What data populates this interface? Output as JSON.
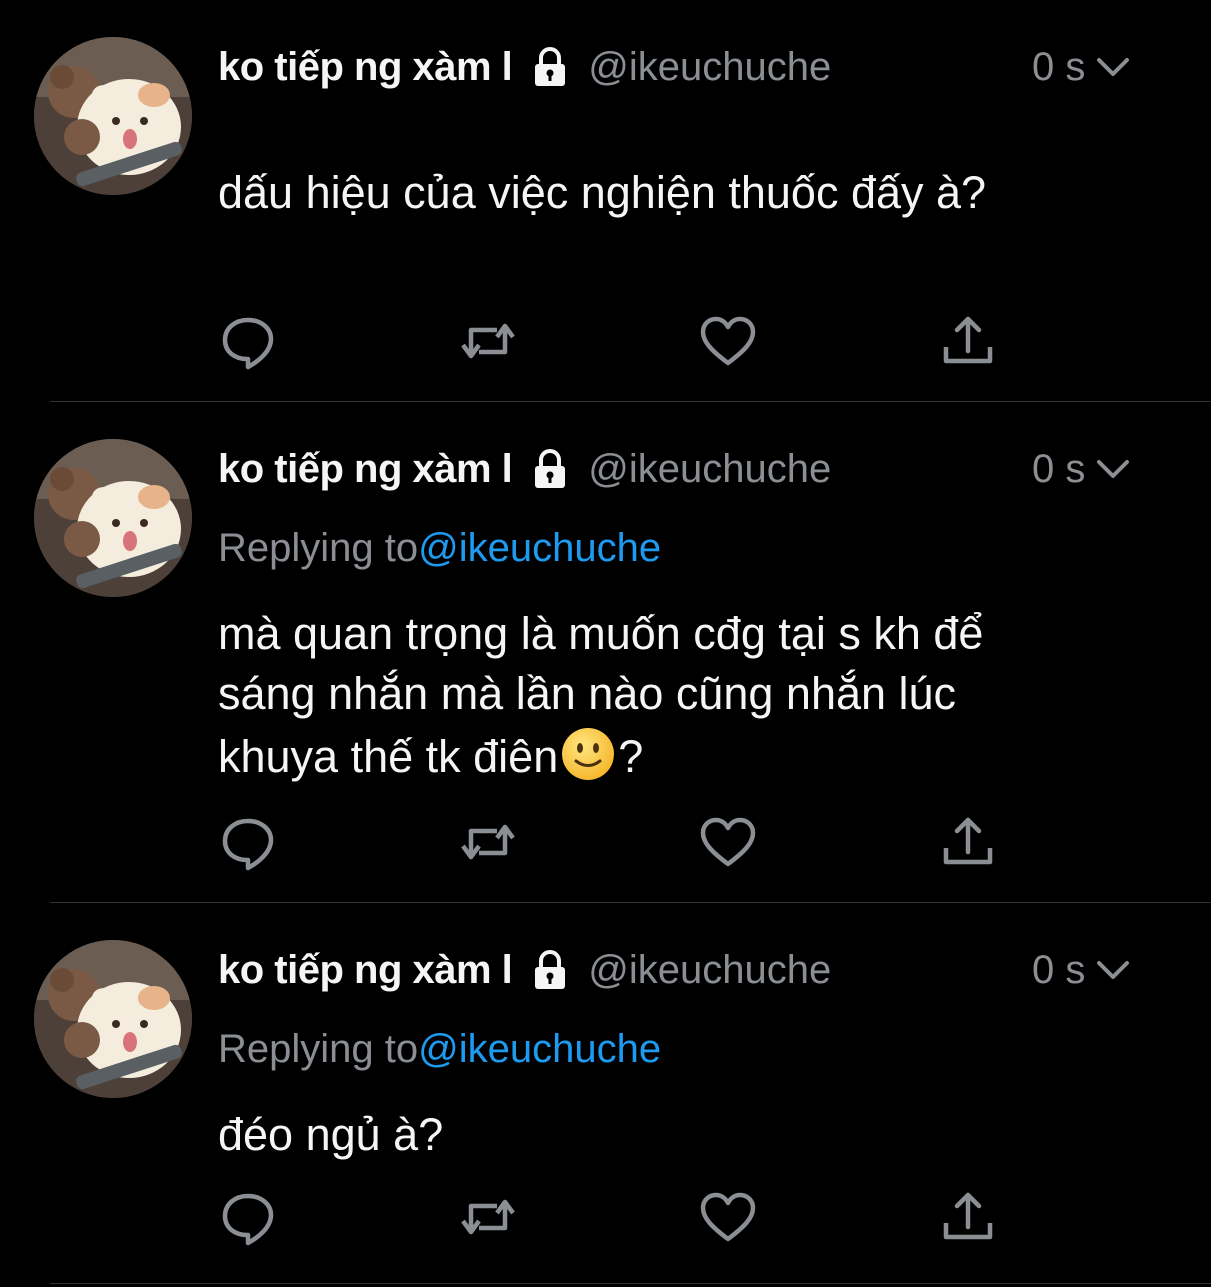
{
  "tweets": [
    {
      "display_name": "ko tiếp ng xàm l",
      "handle": "@ikeuchuche",
      "time": "0 s",
      "replying_prefix": "",
      "replying_to": "",
      "text_lines": [
        "dấu hiệu của việc nghiện thuốc đấy à?"
      ],
      "emoji_after_last_line": "",
      "text_suffix": ""
    },
    {
      "display_name": "ko tiếp ng xàm l",
      "handle": "@ikeuchuche",
      "time": "0 s",
      "replying_prefix": "Replying to",
      "replying_to": "@ikeuchuche",
      "text_lines": [
        "mà quan trọng là muốn cđg tại s kh để",
        "sáng nhắn mà lần nào cũng nhắn lúc",
        "khuya thế tk điên"
      ],
      "emoji_after_last_line": "slightly-smiling-face",
      "text_suffix": "?"
    },
    {
      "display_name": "ko tiếp ng xàm l",
      "handle": "@ikeuchuche",
      "time": "0 s",
      "replying_prefix": "Replying to",
      "replying_to": "@ikeuchuche",
      "text_lines": [
        "đéo ngủ à?"
      ],
      "emoji_after_last_line": "",
      "text_suffix": ""
    }
  ],
  "icons": {
    "reply": "reply-icon",
    "retweet": "retweet-icon",
    "like": "heart-icon",
    "share": "share-icon",
    "lock": "lock-icon",
    "more": "chevron-down-icon"
  },
  "colors": {
    "background": "#000000",
    "text": "#f5f5f5",
    "muted": "#8b8f94",
    "mention": "#1d9bf0",
    "divider": "#2f3336"
  }
}
